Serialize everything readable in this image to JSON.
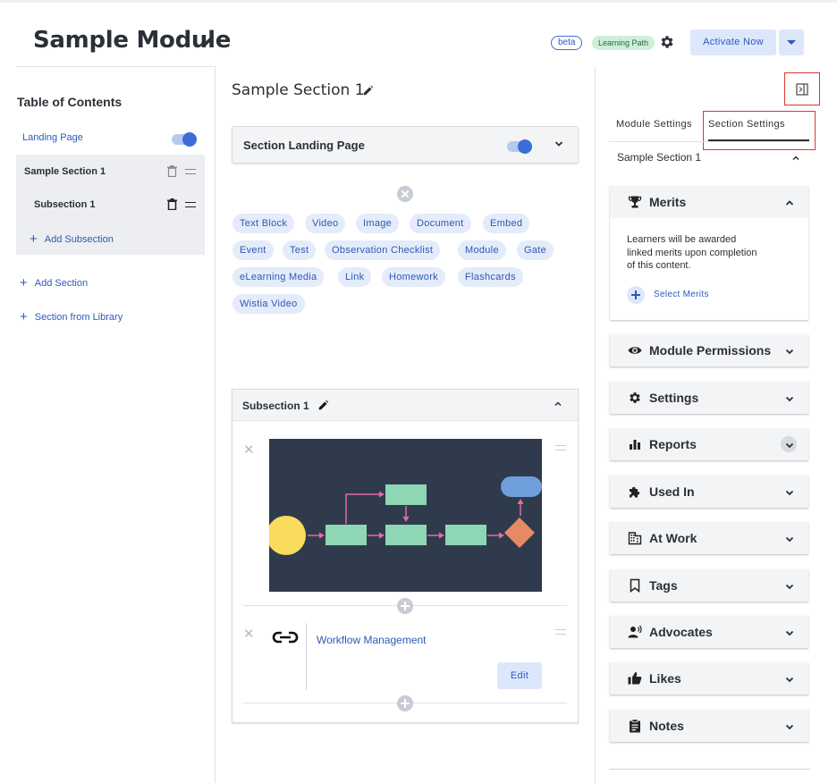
{
  "header": {
    "title": "Sample Module",
    "badge_beta": "beta",
    "badge_learning_path": "Learning Path",
    "activate_label": "Activate Now"
  },
  "toc": {
    "title": "Table of Contents",
    "landing_page": "Landing Page",
    "section": "Sample Section 1",
    "subsection": "Subsection 1",
    "add_subsection": "Add Subsection",
    "add_section": "Add Section",
    "section_from_library": "Section from Library"
  },
  "main": {
    "section_title": "Sample Section 1",
    "landing_card_label": "Section Landing Page",
    "chips": [
      "Text Block",
      "Video",
      "Image",
      "Document",
      "Embed",
      "Event",
      "Test",
      "Observation Checklist",
      "Module",
      "Gate",
      "eLearning Media",
      "Link",
      "Homework",
      "Flashcards",
      "Wistia Video"
    ],
    "subsection_title": "Subsection 1",
    "link_title": "Workflow Management",
    "edit_label": "Edit"
  },
  "panel": {
    "tab_module": "Module Settings",
    "tab_section": "Section Settings",
    "selected_section": "Sample Section 1",
    "merits": {
      "label": "Merits",
      "description": "Learners will be awarded linked merits upon completion of this content.",
      "select_label": "Select Merits"
    },
    "accordions": [
      "Module Permissions",
      "Settings",
      "Reports",
      "Used In",
      "At Work",
      "Tags",
      "Advocates",
      "Likes",
      "Notes"
    ]
  },
  "colors": {
    "accent": "#3b6ed6",
    "accent_text": "#2c5ab8",
    "highlight_red": "#d9382f",
    "diagram_bg": "#2f3b4c"
  }
}
